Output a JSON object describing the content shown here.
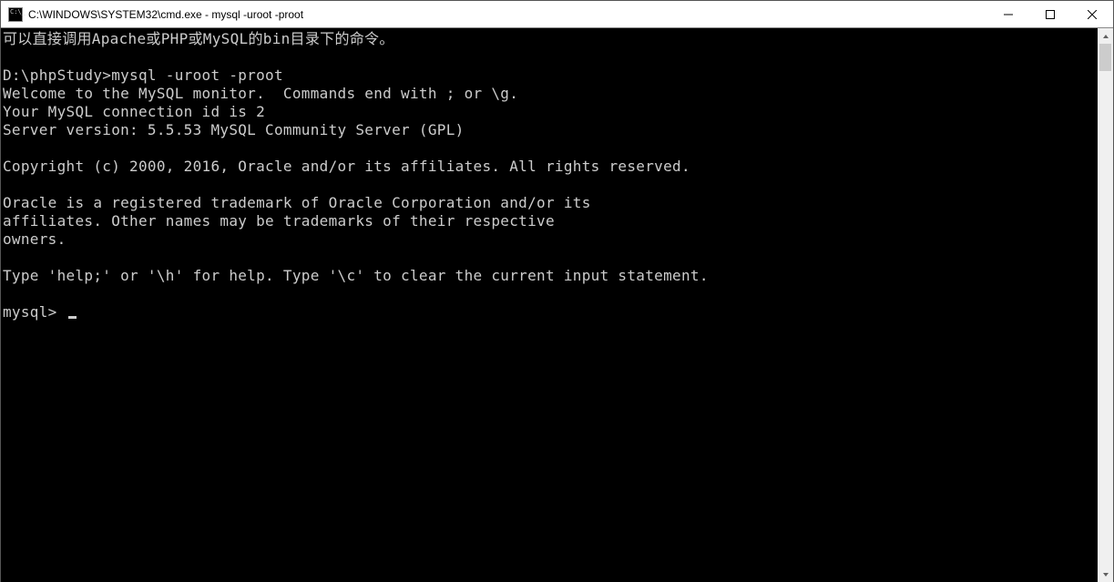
{
  "window": {
    "title": "C:\\WINDOWS\\SYSTEM32\\cmd.exe - mysql  -uroot -proot"
  },
  "terminal": {
    "line_intro": "可以直接调用Apache或PHP或MySQL的bin目录下的命令。",
    "prompt_line": "D:\\phpStudy>mysql -uroot -proot",
    "welcome1": "Welcome to the MySQL monitor.  Commands end with ; or \\g.",
    "welcome2": "Your MySQL connection id is 2",
    "welcome3": "Server version: 5.5.53 MySQL Community Server (GPL)",
    "copyright": "Copyright (c) 2000, 2016, Oracle and/or its affiliates. All rights reserved.",
    "trademark1": "Oracle is a registered trademark of Oracle Corporation and/or its",
    "trademark2": "affiliates. Other names may be trademarks of their respective",
    "trademark3": "owners.",
    "help": "Type 'help;' or '\\h' for help. Type '\\c' to clear the current input statement.",
    "mysql_prompt": "mysql> "
  }
}
